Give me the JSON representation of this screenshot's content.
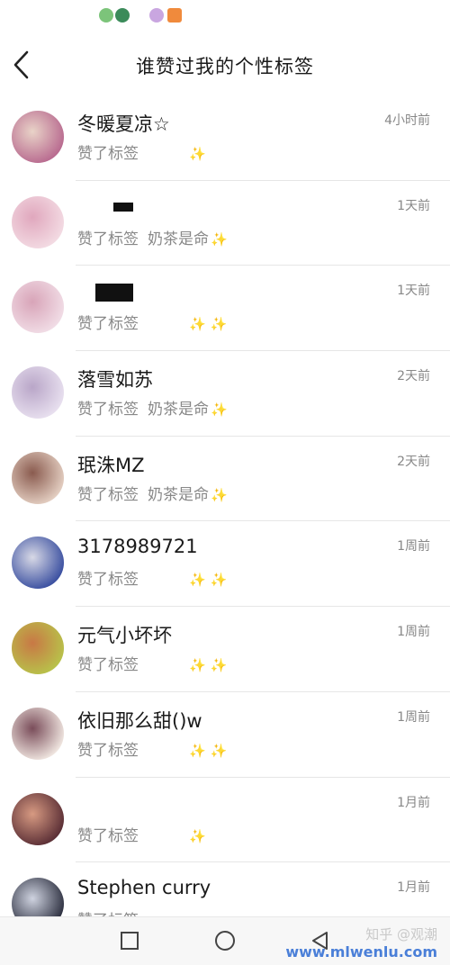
{
  "header": {
    "title": "谁赞过我的个性标签"
  },
  "list": [
    {
      "name": "冬暖夏凉☆",
      "time": "4小时前",
      "prefix": "赞了标签",
      "tag": "",
      "sparkles": "✨",
      "avatar": [
        "#b86a8f",
        "#e9d3c8"
      ]
    },
    {
      "name": "",
      "time": "1天前",
      "prefix": "赞了标签",
      "tag": "奶茶是命",
      "sparkles": "✨",
      "avatar": [
        "#f3dbe3",
        "#e0a7bd"
      ],
      "redact": true
    },
    {
      "name": "",
      "time": "1天前",
      "prefix": "赞了标签",
      "tag": "",
      "sparkles": "✨ ✨",
      "avatar": [
        "#f1dde6",
        "#d8a4b8"
      ],
      "redact": true
    },
    {
      "name": "落雪如苏",
      "time": "2天前",
      "prefix": "赞了标签",
      "tag": "奶茶是命",
      "sparkles": "✨",
      "avatar": [
        "#e8e0ef",
        "#b9a6c8"
      ]
    },
    {
      "name": "珉洙MZ",
      "time": "2天前",
      "prefix": "赞了标签",
      "tag": "奶茶是命",
      "sparkles": "✨",
      "avatar": [
        "#e4cfc2",
        "#8a5b4f"
      ]
    },
    {
      "name": "3178989721",
      "time": "1周前",
      "prefix": "赞了标签",
      "tag": "",
      "sparkles": "✨ ✨",
      "avatar": [
        "#3a4fa0",
        "#d8d9e6"
      ]
    },
    {
      "name": "元气小坏坏",
      "time": "1周前",
      "prefix": "赞了标签",
      "tag": "",
      "sparkles": "✨ ✨",
      "avatar": [
        "#b8c24a",
        "#c87845"
      ]
    },
    {
      "name": "依旧那么甜()w",
      "time": "1周前",
      "prefix": "赞了标签",
      "tag": "",
      "sparkles": "✨ ✨",
      "avatar": [
        "#f0e6e0",
        "#7a4d5a"
      ]
    },
    {
      "name": "",
      "time": "1月前",
      "prefix": "赞了标签",
      "tag": "",
      "sparkles": "✨",
      "avatar": [
        "#5a2e35",
        "#d79a82"
      ]
    },
    {
      "name": "Stephen curry",
      "time": "1月前",
      "prefix": "赞了标签",
      "tag": "",
      "sparkles": "",
      "avatar": [
        "#2d3040",
        "#cfd3e0"
      ]
    }
  ],
  "watermark": {
    "line1": "知乎 @观潮",
    "line2": "www.mlwenlu.com"
  },
  "icons": {
    "back": "chevron-left-icon",
    "recent": "square-icon",
    "home": "circle-icon",
    "nav_back": "triangle-back-icon"
  }
}
